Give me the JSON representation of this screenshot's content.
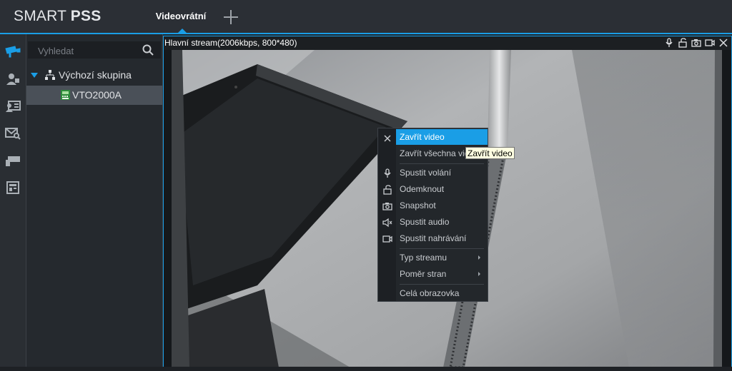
{
  "app": {
    "logo_light": "SMART ",
    "logo_bold": "PSS"
  },
  "tabs": [
    {
      "label": "Videovrátní"
    }
  ],
  "sidebar": {
    "icons": [
      "camera-icon",
      "user-icon",
      "id-card-icon",
      "mail-search-icon",
      "card-reader-icon",
      "panel-icon"
    ]
  },
  "device_panel": {
    "search_placeholder": "Vyhledat",
    "group_label": "Výchozí skupina",
    "device_label": "VTO2000A"
  },
  "video": {
    "stream_label": "Hlavní stream(2006kbps, 800*480)",
    "toolbar_icons": [
      "microphone-icon",
      "unlock-icon",
      "snapshot-icon",
      "record-icon",
      "close-icon"
    ]
  },
  "context_menu": {
    "items": [
      {
        "label": "Zavřít video",
        "icon": "close-icon",
        "highlighted": true
      },
      {
        "label": "Zavřít všechna videa"
      },
      {
        "label": "Spustit volání",
        "icon": "microphone-icon"
      },
      {
        "label": "Odemknout",
        "icon": "unlock-icon"
      },
      {
        "label": "Snapshot",
        "icon": "camera-icon"
      },
      {
        "label": "Spustit audio",
        "icon": "speaker-icon"
      },
      {
        "label": "Spustit nahrávání",
        "icon": "record-icon"
      },
      {
        "label": "Typ streamu",
        "submenu": true
      },
      {
        "label": "Poměr stran",
        "submenu": true
      },
      {
        "label": "Celá obrazovka"
      }
    ]
  },
  "tooltip": {
    "text": "Zavřít video"
  },
  "colors": {
    "accent": "#1a9ee6",
    "background": "#1e2125",
    "panel": "#25292e"
  }
}
